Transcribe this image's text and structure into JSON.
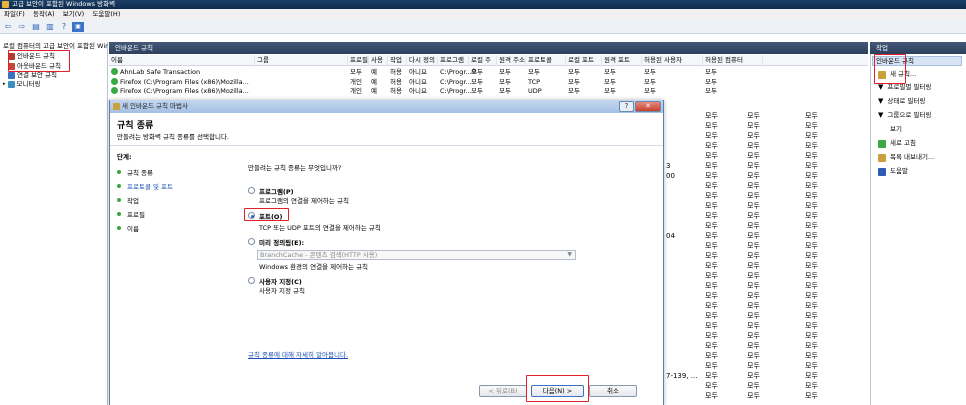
{
  "window": {
    "title": "고급 보안이 포함된 Windows 방화벽"
  },
  "menu": [
    "파일(F)",
    "동작(A)",
    "보기(V)",
    "도움말(H)"
  ],
  "toolbar_icons": [
    "back-arrow-icon",
    "forward-arrow-icon",
    "folder-icon",
    "properties-icon",
    "separator",
    "help-icon",
    "panel-icon"
  ],
  "tree": {
    "root": "로컬 컴퓨터의 고급 보안이 포함된 Windows 방화벽",
    "items": [
      "인바운드 규칙",
      "아웃바운드 규칙",
      "연결 보안 규칙",
      "모니터링"
    ]
  },
  "center": {
    "title": "인바운드 규칙",
    "columns": [
      "이름",
      "그룹",
      "프로필",
      "사용",
      "작업",
      "다시 정의",
      "프로그램",
      "로컬 주소",
      "원격 주소",
      "프로토콜",
      "로컬 포트",
      "원격 포트",
      "허용된 사용자",
      "허용된 컴퓨터"
    ],
    "rows": [
      [
        "AhnLab Safe Transaction",
        "",
        "모두",
        "예",
        "허용",
        "아니요",
        "C:\\Progr...",
        "모두",
        "모두",
        "모두",
        "모두",
        "모두",
        "모두",
        "모두"
      ],
      [
        "Firefox (C:\\Program Files (x86)\\Mozilla...",
        "",
        "개인",
        "예",
        "허용",
        "아니요",
        "C:\\Progr...",
        "모두",
        "모두",
        "TCP",
        "모두",
        "모두",
        "모두",
        "모두"
      ],
      [
        "Firefox (C:\\Program Files (x86)\\Mozilla...",
        "",
        "개인",
        "예",
        "허용",
        "아니요",
        "C:\\Progr...",
        "모두",
        "모두",
        "UDP",
        "모두",
        "모두",
        "모두",
        "모두"
      ]
    ],
    "partial_col": [
      "",
      "",
      "",
      "",
      "",
      "3",
      "00",
      "",
      "",
      "",
      "",
      "",
      "04",
      "",
      "",
      "",
      "",
      "",
      "",
      "",
      "",
      "",
      "",
      "",
      "",
      "",
      "7-139, ...",
      "",
      ""
    ],
    "repeat_value": "모두"
  },
  "actions": {
    "title": "작업",
    "section": "인바운드 규칙",
    "items": [
      {
        "label": "새 규칙...",
        "icon": "new-rule-icon"
      },
      {
        "label": "프로필별 필터링",
        "icon": "filter-icon"
      },
      {
        "label": "상태로 필터링",
        "icon": "filter-icon"
      },
      {
        "label": "그룹으로 필터링",
        "icon": "filter-icon"
      },
      {
        "label": "보기",
        "icon": ""
      },
      {
        "label": "새로 고침",
        "icon": "refresh-icon"
      },
      {
        "label": "목록 내보내기...",
        "icon": "export-icon"
      },
      {
        "label": "도움말",
        "icon": "help-icon"
      }
    ]
  },
  "dialog": {
    "title": "새 인바운드 규칙 마법사",
    "heading": "규칙 종류",
    "subheading": "만들려는 방화벽 규칙 종류를 선택합니다.",
    "steps_label": "단계:",
    "steps": [
      "규칙 종류",
      "프로토콜 및 포트",
      "작업",
      "프로필",
      "이름"
    ],
    "question": "만들려는 규칙 종류는 무엇입니까?",
    "options": [
      {
        "label": "프로그램(P)",
        "desc": "프로그램의 연결을 제어하는 규칙",
        "selected": false
      },
      {
        "label": "포트(O)",
        "desc": "TCP 또는 UDP 포트의 연결을 제어하는 규칙",
        "selected": true
      },
      {
        "label": "미리 정의됨(E):",
        "desc": "Windows 환경의 연결을 제어하는 규칙",
        "selected": false
      },
      {
        "label": "사용자 지정(C)",
        "desc": "사용자 지정 규칙",
        "selected": false
      }
    ],
    "predefined_value": "BranchCache - 콘텐츠 검색(HTTP 사용)",
    "learn_more": "규칙 종류에 대해 자세히 알아봅니다.",
    "buttons": {
      "back": "< 뒤로(B)",
      "next": "다음(N) >",
      "cancel": "취소"
    }
  }
}
